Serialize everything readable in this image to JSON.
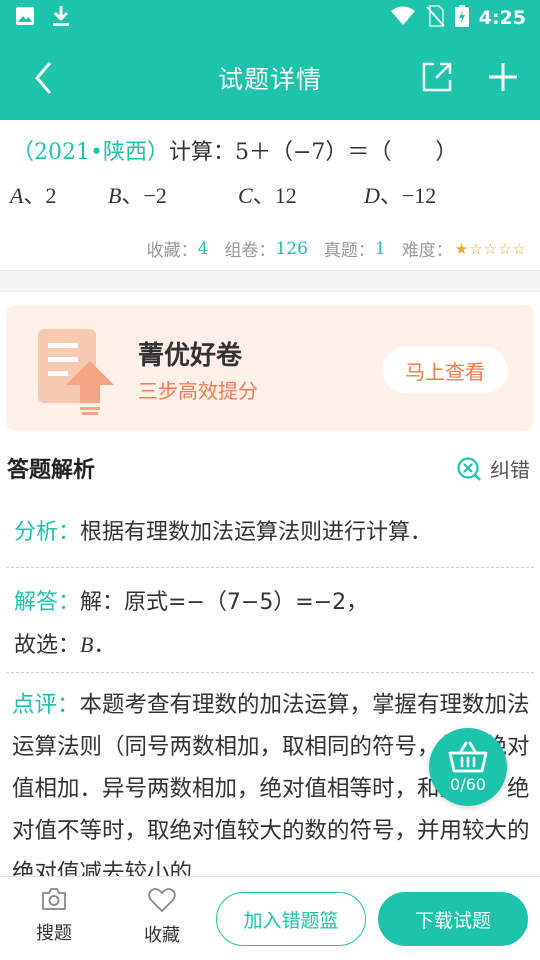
{
  "status_bar": {
    "time": "4:25"
  },
  "header": {
    "title": "试题详情"
  },
  "question": {
    "source": "（2021•陕西）",
    "stem": "计算：5＋（−7）＝（　　）",
    "options": [
      {
        "letter": "A",
        "text": "、2"
      },
      {
        "letter": "B",
        "text": "、−2"
      },
      {
        "letter": "C",
        "text": "、12"
      },
      {
        "letter": "D",
        "text": "、−12"
      }
    ]
  },
  "stats": {
    "favorites_label": "收藏：",
    "favorites": "4",
    "papers_label": "组卷：",
    "papers": "126",
    "real_label": "真题：",
    "real": "1",
    "difficulty_label": "难度：",
    "difficulty_stars": 1,
    "difficulty_max": 5
  },
  "promo": {
    "title": "菁优好卷",
    "subtitle": "三步高效提分",
    "button": "马上查看"
  },
  "answer": {
    "heading": "答题解析",
    "report_label": "纠错",
    "analysis_label": "分析：",
    "analysis_text": "根据有理数加法运算法则进行计算．",
    "solution_label": "解答：",
    "solution_line1": "解：原式=−（7−5）=−2，",
    "solution_line2_prefix": "故选：",
    "solution_choice": "B",
    "solution_line2_suffix": "．",
    "comment_label": "点评：",
    "comment_text": "本题考查有理数的加法运算，掌握有理数加法运算法则（同号两数相加，取相同的符号，并把绝对值相加．异号两数相加，绝对值相等时，和为零；绝对值不等时，取绝对值较大的数的符号，并用较大的绝对值减去较小的"
  },
  "basket": {
    "count": "0/60"
  },
  "bottom_bar": {
    "search_label": "搜题",
    "favorite_label": "收藏",
    "add_wrong_label": "加入错题篮",
    "download_label": "下载试题"
  },
  "colors": {
    "accent": "#1dc3ab",
    "promo_orange": "#f07b4d",
    "promo_bg": "#fff0ea",
    "star": "#f0a928"
  }
}
